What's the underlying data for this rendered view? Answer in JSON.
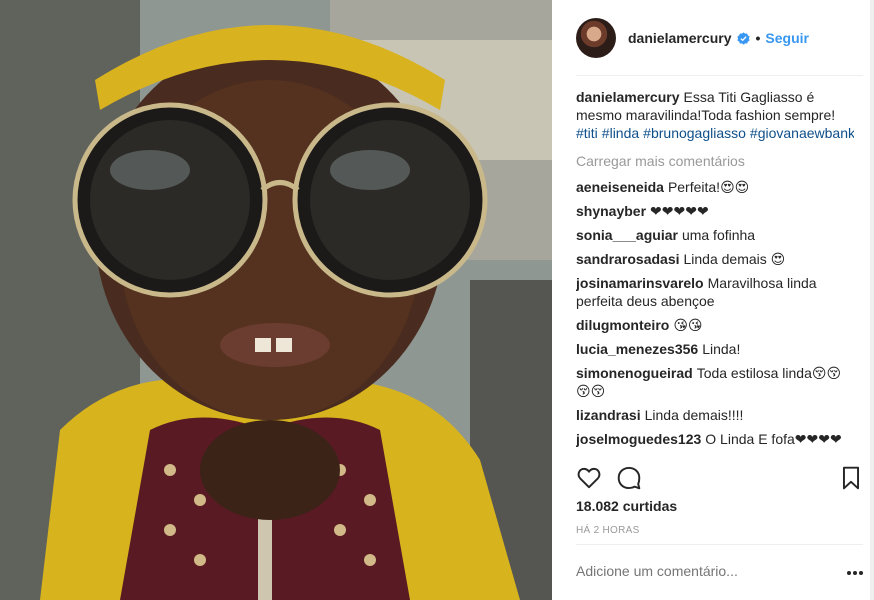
{
  "post": {
    "username": "danielamercury",
    "follow_label": "Seguir",
    "separator": "•",
    "caption_user": "danielamercury",
    "caption_text": "Essa Titi Gagliasso é mesmo maravilinda!Toda fashion sempre!",
    "hashtags": [
      "#titi",
      "#linda",
      "#brunogagliasso",
      "#giovanaewbank"
    ],
    "load_more": "Carregar mais comentários",
    "likes": "18.082 curtidas",
    "timestamp": "HÁ 2 HORAS",
    "add_comment_placeholder": "Adicione um comentário..."
  },
  "comments": [
    {
      "user": "aeneiseneida",
      "text": "Perfeita!😍😍"
    },
    {
      "user": "shynayber",
      "text": "❤❤❤❤❤"
    },
    {
      "user": "sonia___aguiar",
      "text": "uma fofinha"
    },
    {
      "user": "sandrarosadasi",
      "text": "Linda demais 😍"
    },
    {
      "user": "josinamarinsvarelo",
      "text": "Maravilhosa linda perfeita deus abençoe"
    },
    {
      "user": "dilugmonteiro",
      "text": "😘😘"
    },
    {
      "user": "lucia_menezes356",
      "text": "Linda!"
    },
    {
      "user": "simonenogueirad",
      "text": "Toda estilosa linda😚😚😚😚"
    },
    {
      "user": "lizandrasi",
      "text": "Linda demais!!!!"
    },
    {
      "user": "joselmoguedes123",
      "text": "O Linda E fofa❤❤❤❤"
    }
  ],
  "icons": {
    "like": "heart-icon",
    "comment": "comment-bubble-icon",
    "save": "bookmark-icon",
    "options": "more-options-icon",
    "verified": "verified-badge-icon"
  },
  "colors": {
    "link_blue": "#3897f0",
    "hashtag": "#0f4f8a",
    "muted": "#999999",
    "text": "#262626"
  }
}
